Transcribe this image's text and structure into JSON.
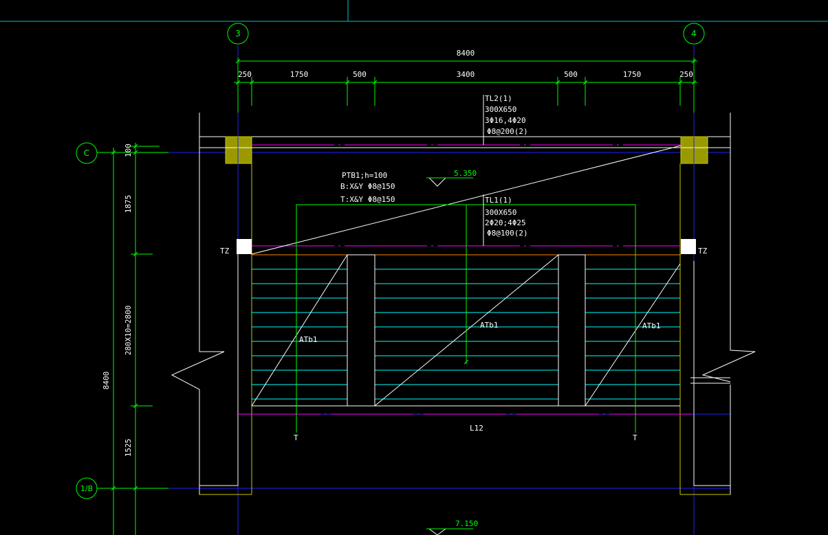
{
  "grid_axes": {
    "top": [
      "3",
      "4"
    ],
    "left": [
      "C",
      "1/B"
    ]
  },
  "dimensions": {
    "overall_top": "8400",
    "top_segments": [
      "250",
      "1750",
      "500",
      "3400",
      "500",
      "1750",
      "250"
    ],
    "left_segments": [
      "100",
      "1875",
      "280X10=2800",
      "1525"
    ],
    "overall_left": "8400"
  },
  "beams": {
    "tl2": {
      "name": "TL2(1)",
      "section": "300X650",
      "rebar": "3Φ16,4Φ20",
      "stirrup": "Φ8@200(2)"
    },
    "tl1": {
      "name": "TL1(1)",
      "section": "300X650",
      "rebar": "2Φ20;4Φ25",
      "stirrup": "Φ8@100(2)"
    }
  },
  "slab": {
    "name": "PTB1;h=100",
    "bottom": "B:X&Y Φ8@150",
    "top": "T:X&Y Φ8@150"
  },
  "elevations": [
    "5.350",
    "7.150"
  ],
  "labels": {
    "tz_left": "TZ",
    "tz_right": "TZ",
    "stair_left": "ATb1",
    "stair_mid": "ATb1",
    "stair_right": "ATb1",
    "l12": "L12",
    "section_left": "T",
    "section_right": "T"
  },
  "colors": {
    "background": "#000000",
    "grid_line": "#0000ff",
    "dimension": "#00ff00",
    "wall": "#ffffff",
    "column_fill": "#9a9a00",
    "tread": "#00ffff",
    "beam_centerline": "#ff00ff",
    "edge_orange": "#ff8800"
  }
}
